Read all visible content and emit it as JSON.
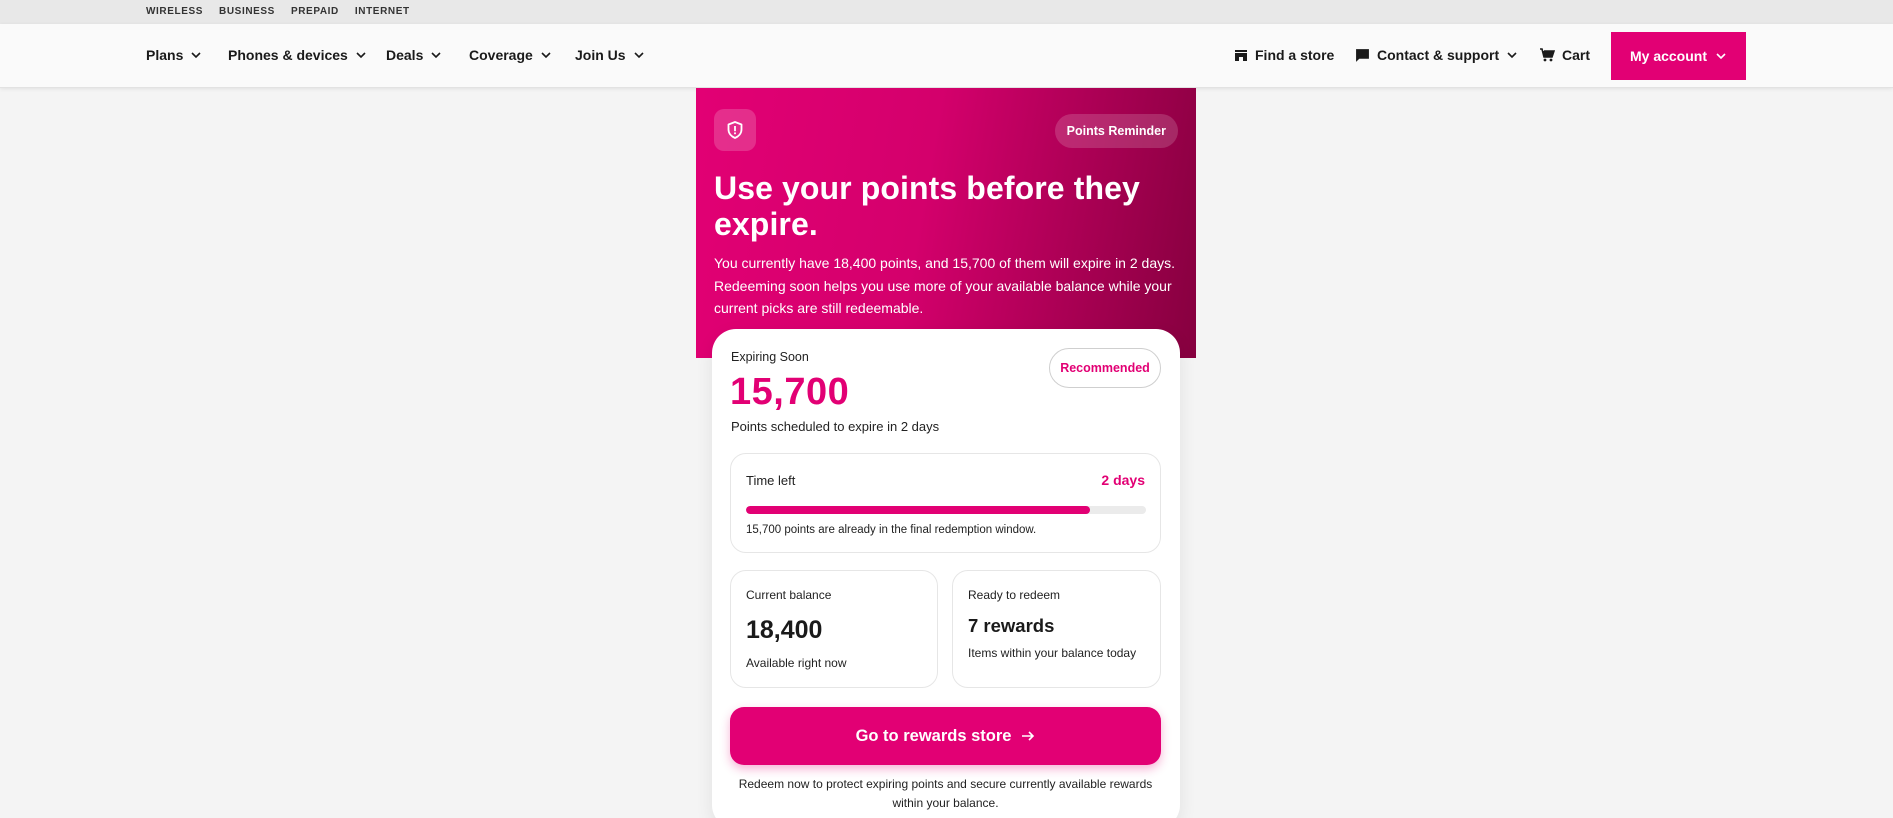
{
  "utility_nav": [
    "WIRELESS",
    "BUSINESS",
    "PREPAID",
    "INTERNET"
  ],
  "main_nav": {
    "plans": "Plans",
    "phones": "Phones & devices",
    "deals": "Deals",
    "coverage": "Coverage",
    "join": "Join Us",
    "find_store": "Find a store",
    "contact": "Contact & support",
    "cart": "Cart",
    "account": "My account"
  },
  "hero": {
    "chip": "Points Reminder",
    "title": "Use your points before they expire.",
    "body": "You currently have 18,400 points, and 15,700 of them will expire in 2 days. Redeeming soon helps you use more of your available balance while your current picks are still redeemable."
  },
  "card": {
    "expiring_label": "Expiring Soon",
    "expiring_points": "15,700",
    "expiring_sub": "Points scheduled to expire in 2 days",
    "recommended": "Recommended",
    "time_left_label": "Time left",
    "time_left_value": "2 days",
    "progress_fraction": 0.86,
    "time_note": "15,700 points are already in the final redemption window.",
    "balance_label": "Current balance",
    "balance_value": "18,400",
    "balance_sub": "Available right now",
    "redeem_label": "Ready to redeem",
    "redeem_value": "7 rewards",
    "redeem_sub": "Items within your balance today",
    "cta": "Go to rewards store",
    "footnote": "Redeem now to protect expiring points and secure currently available rewards within your balance."
  },
  "colors": {
    "brand": "#e20074",
    "brand_dark": "#86003f"
  },
  "icons": {
    "shield": "shield-alert-icon",
    "chevron": "chevron-down-icon",
    "store": "store-icon",
    "chat": "chat-bubble-icon",
    "cart": "cart-icon",
    "arrow": "arrow-right-icon"
  }
}
